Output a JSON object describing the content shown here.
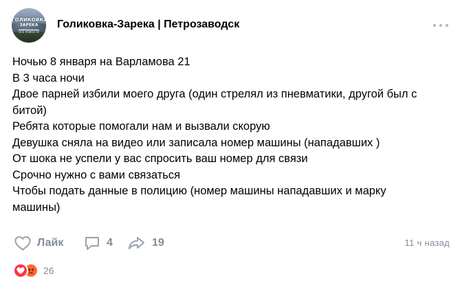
{
  "header": {
    "group_name": "Голиковка-Зарека | Петрозаводск",
    "avatar_logo": {
      "line1": "ГОЛИКОВКА",
      "line2": "ЗАРЕКА",
      "line3": "ВСЕ НОВОСТИ"
    },
    "more_icon": "more-horizontal-icon"
  },
  "post": {
    "lines": [
      "Ночью 8 января на Варламова 21",
      "В 3 часа ночи",
      "Двое парней избили моего друга (один стрелял из пневматики, другой был с",
      "битой)",
      "Ребята которые помогали нам и вызвали скорую",
      "Девушка сняла на видео или записала номер машины (нападавших )",
      "От шока не успели у вас спросить ваш номер для связи",
      "Срочно нужно с вами связаться",
      "Чтобы подать данные в полицию (номер машины нападавших и марку",
      "машины)"
    ]
  },
  "footer": {
    "like_label": "Лайк",
    "like_icon": "heart-outline-icon",
    "comments_count": "4",
    "comments_icon": "comment-icon",
    "shares_count": "19",
    "shares_icon": "share-arrow-icon",
    "timestamp": "11 ч назад"
  },
  "reactions": {
    "icons": [
      "heart-reaction-icon",
      "angry-reaction-icon"
    ],
    "count": "26"
  },
  "colors": {
    "text": "#000000",
    "secondary": "#818c99",
    "heart_reaction": "#ff3347",
    "angry_reaction": "#ff6a2e"
  }
}
